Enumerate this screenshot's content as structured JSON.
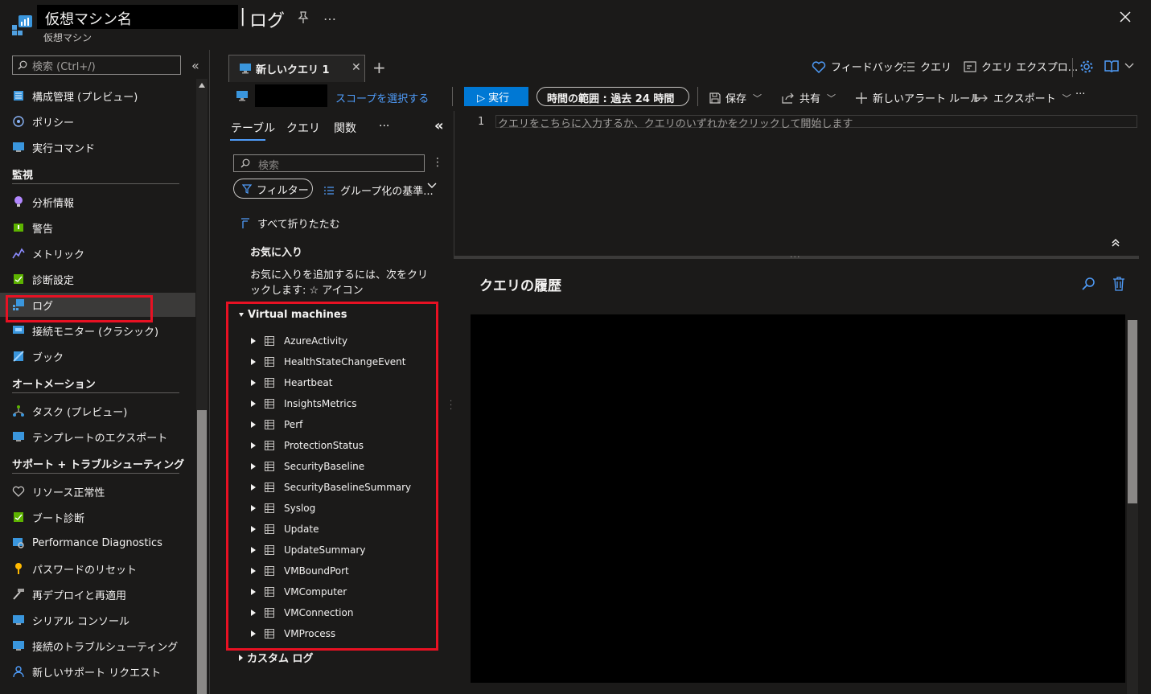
{
  "header": {
    "vm_name": "仮想マシン名",
    "title_separator": "|",
    "page_title": "ログ",
    "resource_type": "仮想マシン",
    "more": "…",
    "close": "✕"
  },
  "sidebar": {
    "search_placeholder": "検索 (Ctrl+/)",
    "collapse": "«",
    "items_top": [
      {
        "label": "構成管理 (プレビュー)",
        "icon": "config-icon"
      },
      {
        "label": "ポリシー",
        "icon": "policy-icon"
      },
      {
        "label": "実行コマンド",
        "icon": "run-command-icon"
      }
    ],
    "sections": [
      {
        "title": "監視",
        "items": [
          {
            "label": "分析情報",
            "icon": "insights-icon"
          },
          {
            "label": "警告",
            "icon": "alerts-icon"
          },
          {
            "label": "メトリック",
            "icon": "metrics-icon"
          },
          {
            "label": "診断設定",
            "icon": "diagnostics-icon"
          },
          {
            "label": "ログ",
            "icon": "logs-icon",
            "selected": true
          },
          {
            "label": "接続モニター (クラシック)",
            "icon": "connection-monitor-icon"
          },
          {
            "label": "ブック",
            "icon": "workbook-icon"
          }
        ]
      },
      {
        "title": "オートメーション",
        "items": [
          {
            "label": "タスク (プレビュー)",
            "icon": "tasks-icon"
          },
          {
            "label": "テンプレートのエクスポート",
            "icon": "export-template-icon"
          }
        ]
      },
      {
        "title": "サポート + トラブルシューティング",
        "items": [
          {
            "label": "リソース正常性",
            "icon": "health-icon"
          },
          {
            "label": "ブート診断",
            "icon": "boot-diagnostics-icon"
          },
          {
            "label": "Performance Diagnostics",
            "icon": "perf-diagnostics-icon"
          },
          {
            "label": "パスワードのリセット",
            "icon": "key-icon"
          },
          {
            "label": "再デプロイと再適用",
            "icon": "hammer-icon"
          },
          {
            "label": "シリアル コンソール",
            "icon": "console-icon"
          },
          {
            "label": "接続のトラブルシューティング",
            "icon": "connection-troubleshoot-icon"
          },
          {
            "label": "新しいサポート リクエスト",
            "icon": "support-icon"
          }
        ]
      }
    ]
  },
  "tabs": {
    "active_label": "新しいクエリ 1",
    "close": "✕",
    "add": "+",
    "right": {
      "feedback": "フィードバック",
      "queries": "クエリ",
      "query_explorer": "クエリ エクスプロ..."
    }
  },
  "toolbar": {
    "select_scope": "スコープを選択する",
    "run": "▷ 実行",
    "time_range": "時間の範囲 : 過去 24 時間",
    "save": "保存",
    "share": "共有",
    "new_alert": "新しいアラート ルール",
    "export": "エクスポート",
    "more": "···"
  },
  "schema": {
    "tabs": [
      "テーブル",
      "クエリ",
      "関数",
      "···"
    ],
    "collapse_pane": "«",
    "search_placeholder": "検索",
    "filter": "フィルター",
    "group_by": "グループ化の基準...",
    "collapse_all": "すべて折りたたむ",
    "favorites_title": "お気に入り",
    "favorites_desc": "お気に入りを追加するには、次をクリックします: ☆ アイコン",
    "group_vm": "Virtual machines",
    "tables": [
      "AzureActivity",
      "HealthStateChangeEvent",
      "Heartbeat",
      "InsightsMetrics",
      "Perf",
      "ProtectionStatus",
      "SecurityBaseline",
      "SecurityBaselineSummary",
      "Syslog",
      "Update",
      "UpdateSummary",
      "VMBoundPort",
      "VMComputer",
      "VMConnection",
      "VMProcess"
    ],
    "group_custom": "カスタム ログ"
  },
  "editor": {
    "line_number": "1",
    "placeholder": "クエリをこちらに入力するか、クエリのいずれかをクリックして開始します"
  },
  "results": {
    "history_title": "クエリの履歴"
  },
  "colors": {
    "accent": "#0078d4",
    "link": "#4f9cf9",
    "highlight": "#e81123",
    "background": "#1b1a19"
  }
}
